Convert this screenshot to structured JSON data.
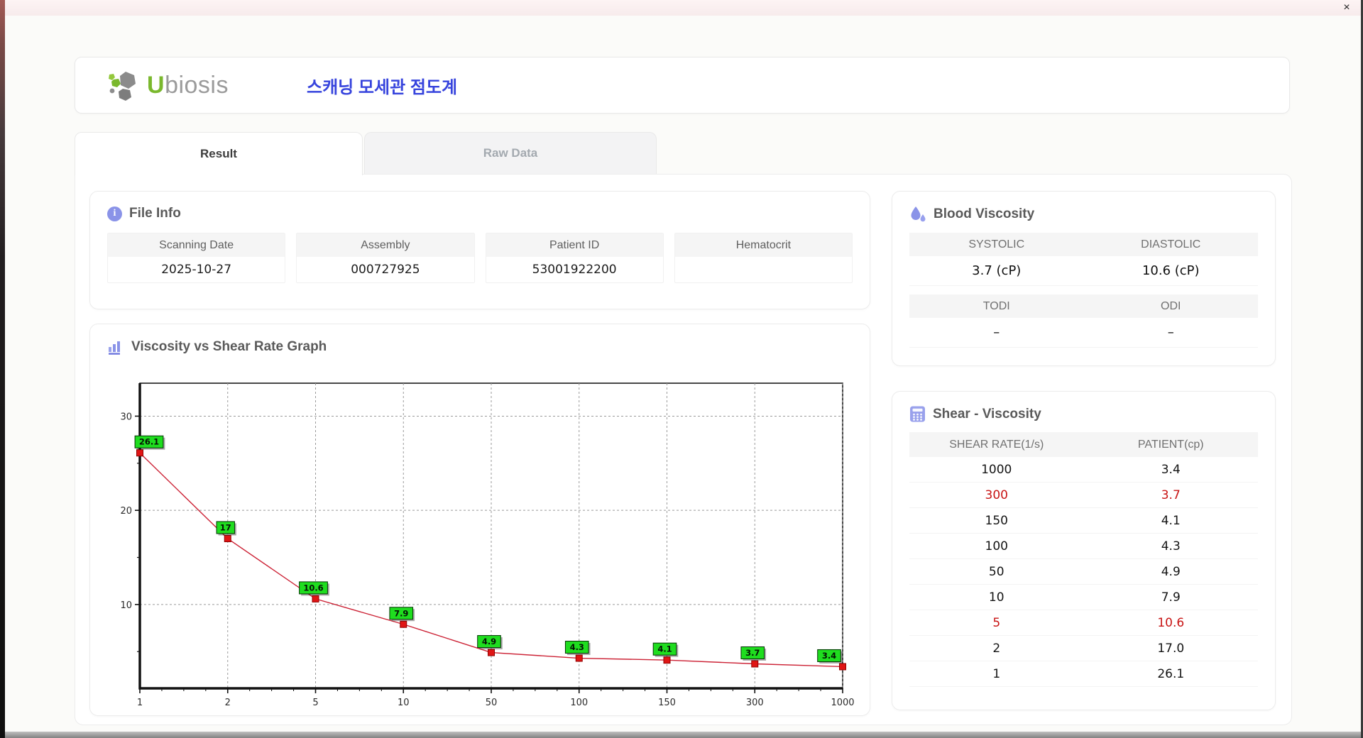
{
  "titlebar": {
    "close_label": "×"
  },
  "header": {
    "brand_u": "U",
    "brand_rest": "biosis",
    "app_title": "스캐닝 모세관 점도계"
  },
  "tabs": {
    "result": "Result",
    "raw_data": "Raw Data"
  },
  "file_info": {
    "title": "File Info",
    "fields": [
      {
        "label": "Scanning Date",
        "value": "2025-10-27"
      },
      {
        "label": "Assembly",
        "value": "000727925"
      },
      {
        "label": "Patient ID",
        "value": "53001922200"
      },
      {
        "label": "Hematocrit",
        "value": ""
      }
    ]
  },
  "blood_viscosity": {
    "title": "Blood Viscosity",
    "systolic_label": "SYSTOLIC",
    "systolic_value": "3.7 (cP)",
    "diastolic_label": "DIASTOLIC",
    "diastolic_value": "10.6 (cP)",
    "todi_label": "TODI",
    "todi_value": "–",
    "odi_label": "ODI",
    "odi_value": "–"
  },
  "shear_viscosity": {
    "title": "Shear - Viscosity",
    "columns": [
      "SHEAR RATE(1/s)",
      "PATIENT(cp)"
    ],
    "rows": [
      {
        "shear_rate": "1000",
        "patient": "3.4",
        "highlight": false
      },
      {
        "shear_rate": "300",
        "patient": "3.7",
        "highlight": true
      },
      {
        "shear_rate": "150",
        "patient": "4.1",
        "highlight": false
      },
      {
        "shear_rate": "100",
        "patient": "4.3",
        "highlight": false
      },
      {
        "shear_rate": "50",
        "patient": "4.9",
        "highlight": false
      },
      {
        "shear_rate": "10",
        "patient": "7.9",
        "highlight": false
      },
      {
        "shear_rate": "5",
        "patient": "10.6",
        "highlight": true
      },
      {
        "shear_rate": "2",
        "patient": "17.0",
        "highlight": false
      },
      {
        "shear_rate": "1",
        "patient": "26.1",
        "highlight": false
      }
    ]
  },
  "graph": {
    "title": "Viscosity vs Shear Rate Graph"
  },
  "chart_data": {
    "type": "line",
    "title": "Viscosity vs Shear Rate Graph",
    "x": [
      1,
      2,
      5,
      10,
      50,
      100,
      150,
      300,
      1000
    ],
    "x_tick_labels": [
      "1",
      "2",
      "5",
      "10",
      "50",
      "100",
      "150",
      "300",
      "1000"
    ],
    "values": [
      26.1,
      17,
      10.6,
      7.9,
      4.9,
      4.3,
      4.1,
      3.7,
      3.4
    ],
    "point_labels": [
      "26.1",
      "17",
      "10.6",
      "7.9",
      "4.9",
      "4.3",
      "4.1",
      "3.7",
      "3.4"
    ],
    "y_ticks": [
      10,
      20,
      30
    ],
    "y_minor_ticks": [
      5,
      15,
      25
    ],
    "ylim": [
      1.1,
      33.5
    ],
    "x_scale": "even-spaced-log-categories",
    "grid": true,
    "legend": "none",
    "line_color": "#cc2235",
    "marker_color": "#e01515",
    "marker_edge": "#8f0000",
    "label_bg": "#1fdd1f",
    "label_border": "#043304",
    "grid_color": "#9a9a9a",
    "frame_color": "#1a1a1a"
  },
  "colors": {
    "accent": "#8a93e8",
    "title_blue": "#3744dd",
    "highlight_red": "#c81414",
    "brand_green": "#7ab82d"
  }
}
